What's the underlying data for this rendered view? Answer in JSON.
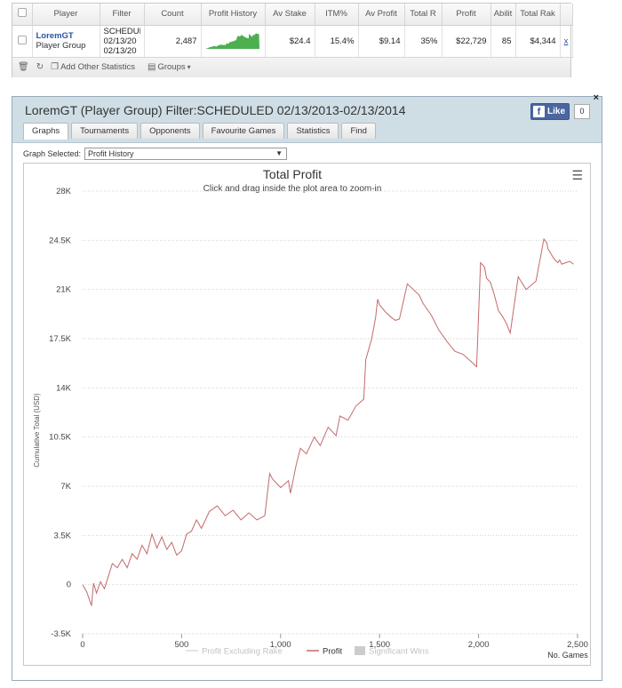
{
  "stats_table": {
    "columns": [
      "Player",
      "Filter",
      "Count",
      "Profit History",
      "Av Stake",
      "ITM%",
      "Av Profit",
      "Total R",
      "Profit",
      "Abilit",
      "Total Rak"
    ],
    "row": {
      "player_name": "LoremGT",
      "player_type": "Player Group",
      "filter_lines": [
        "SCHEDUL",
        "02/13/20",
        "02/13/20"
      ],
      "count": "2,487",
      "av_stake": "$24.4",
      "itm": "15.4%",
      "av_profit": "$9.14",
      "total_r": "35%",
      "profit": "$22,729",
      "ability": "85",
      "total_rake": "$4,344",
      "remove": "x"
    },
    "footer": {
      "add_stats": "Add Other Statistics",
      "groups": "Groups"
    }
  },
  "window": {
    "title": "LoremGT (Player Group) Filter:SCHEDULED 02/13/2013-02/13/2014",
    "like_label": "Like",
    "like_count": "0",
    "close": "×",
    "tabs": [
      "Graphs",
      "Tournaments",
      "Opponents",
      "Favourite Games",
      "Statistics",
      "Find"
    ],
    "graph_selected_label": "Graph Selected:",
    "graph_selected_value": "Profit History"
  },
  "colors": {
    "profit_line": "#c46a6a",
    "sparkline": "#4caf50",
    "header_bg": "#cfdde5"
  },
  "chart_data": {
    "type": "line",
    "title": "Total Profit",
    "subtitle": "Click and drag inside the plot area to zoom-in",
    "ylabel": "Cumulative Total (USD)",
    "xlabel": "No. Games",
    "ylim": [
      -3500,
      28000
    ],
    "xlim": [
      0,
      2500
    ],
    "y_ticks": [
      "-3.5K",
      "0",
      "3.5K",
      "7K",
      "10.5K",
      "14K",
      "17.5K",
      "21K",
      "24.5K",
      "28K"
    ],
    "x_ticks": [
      "0",
      "500",
      "1,000",
      "1,500",
      "2,000",
      "2,500"
    ],
    "legend": [
      "Profit Excluding Rake",
      "Profit",
      "Significant Wins"
    ],
    "series": [
      {
        "name": "Profit",
        "x": [
          0,
          20,
          45,
          55,
          70,
          90,
          110,
          130,
          150,
          175,
          200,
          225,
          250,
          275,
          300,
          325,
          350,
          375,
          400,
          425,
          450,
          475,
          500,
          525,
          550,
          575,
          600,
          640,
          680,
          720,
          760,
          800,
          840,
          880,
          920,
          945,
          960,
          1000,
          1040,
          1050,
          1080,
          1100,
          1130,
          1170,
          1200,
          1240,
          1280,
          1300,
          1340,
          1380,
          1420,
          1430,
          1460,
          1480,
          1490,
          1500,
          1530,
          1560,
          1580,
          1600,
          1640,
          1700,
          1720,
          1760,
          1800,
          1840,
          1880,
          1920,
          1960,
          1990,
          2010,
          2030,
          2040,
          2060,
          2080,
          2100,
          2120,
          2140,
          2160,
          2200,
          2240,
          2290,
          2330,
          2345,
          2350,
          2380,
          2400,
          2410,
          2420,
          2440,
          2460,
          2480
        ],
        "y": [
          0,
          -500,
          -1500,
          100,
          -600,
          200,
          -300,
          600,
          1500,
          1200,
          1800,
          1200,
          2200,
          1800,
          2800,
          2200,
          3600,
          2600,
          3400,
          2500,
          3000,
          2100,
          2400,
          3600,
          3800,
          4600,
          4000,
          5200,
          5600,
          4900,
          5300,
          4600,
          5100,
          4600,
          4900,
          7900,
          7500,
          6900,
          7400,
          6500,
          8600,
          9700,
          9300,
          10500,
          9900,
          11200,
          10600,
          12000,
          11700,
          12700,
          13200,
          16000,
          17500,
          19000,
          20300,
          19900,
          19400,
          19000,
          18800,
          18900,
          21400,
          20600,
          20000,
          19200,
          18100,
          17300,
          16600,
          16400,
          15900,
          15500,
          22900,
          22600,
          21800,
          21500,
          20600,
          19500,
          19100,
          18600,
          17900,
          21900,
          21000,
          21600,
          24600,
          24300,
          23900,
          23200,
          22900,
          23100,
          22800,
          22900,
          23000,
          22800
        ]
      }
    ]
  }
}
